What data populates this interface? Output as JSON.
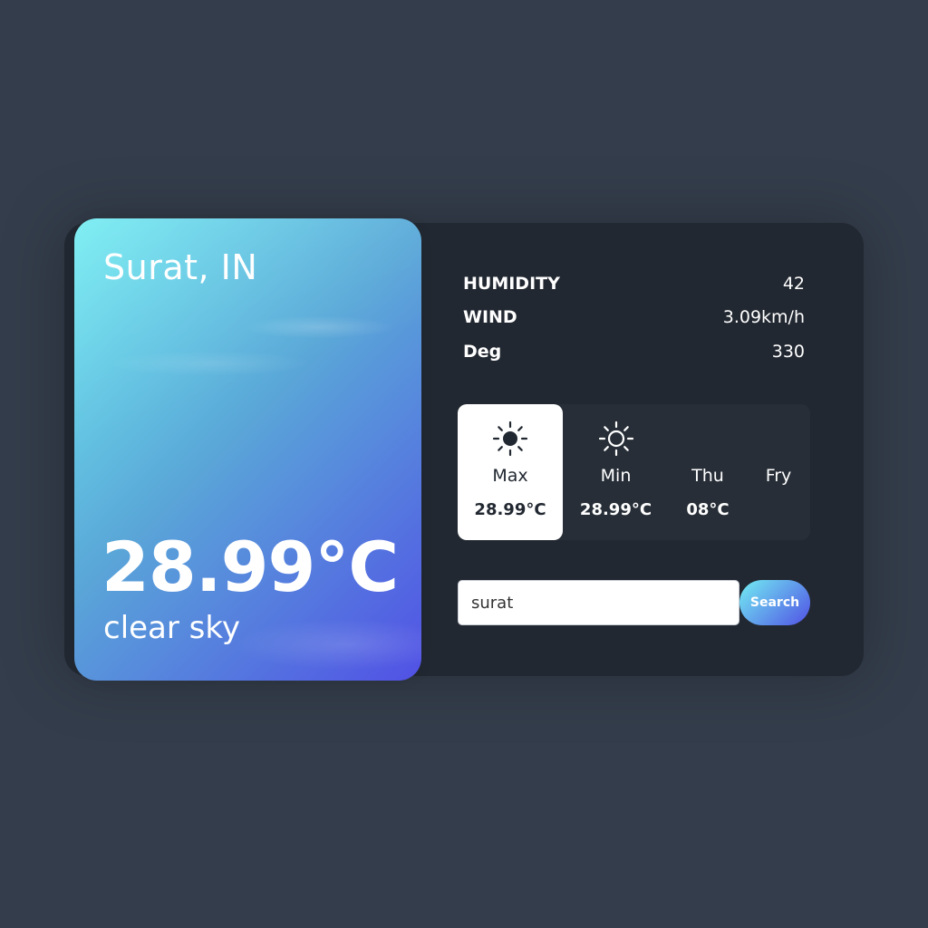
{
  "location": "Surat, IN",
  "current": {
    "temperature": "28.99°C",
    "description": "clear sky"
  },
  "details": [
    {
      "label": "HUMIDITY",
      "value": "42"
    },
    {
      "label": "WIND",
      "value": "3.09km/h"
    },
    {
      "label": "Deg",
      "value": "330"
    }
  ],
  "week": [
    {
      "name": "Max",
      "temp": "28.99°C",
      "icon": "sun-icon",
      "active": true
    },
    {
      "name": "Min",
      "temp": "28.99°C",
      "icon": "sun-outline-icon",
      "active": false
    },
    {
      "name": "Thu",
      "temp": "08°C",
      "icon": "",
      "active": false
    },
    {
      "name": "Fry",
      "temp": "",
      "icon": "",
      "active": false
    }
  ],
  "search": {
    "value": "surat",
    "button_label": "Search"
  },
  "colors": {
    "background": "#343d4b",
    "panel": "#222831",
    "gradient_start": "#72edf2",
    "gradient_end": "#5151e5"
  }
}
